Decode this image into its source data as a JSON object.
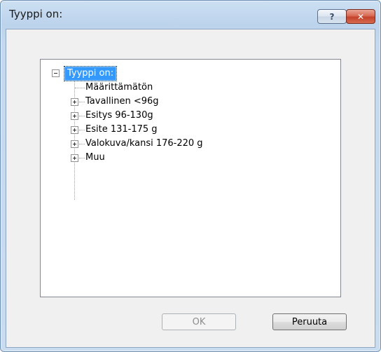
{
  "dialog": {
    "title": "Tyyppi on:",
    "help_glyph": "?",
    "close_glyph": "✕"
  },
  "tree": {
    "root": {
      "label": "Tyyppi on:",
      "expander": "minus"
    },
    "items": [
      {
        "label": "Määrittämätön",
        "expander": "none"
      },
      {
        "label": "Tavallinen <96g",
        "expander": "plus"
      },
      {
        "label": "Esitys 96-130g",
        "expander": "plus"
      },
      {
        "label": "Esite 131-175 g",
        "expander": "plus"
      },
      {
        "label": "Valokuva/kansi 176-220 g",
        "expander": "plus"
      },
      {
        "label": "Muu",
        "expander": "plus"
      }
    ]
  },
  "buttons": {
    "ok_label": "OK",
    "cancel_label": "Peruuta"
  },
  "colors": {
    "selection": "#3399ff",
    "close_button": "#c3422b"
  }
}
